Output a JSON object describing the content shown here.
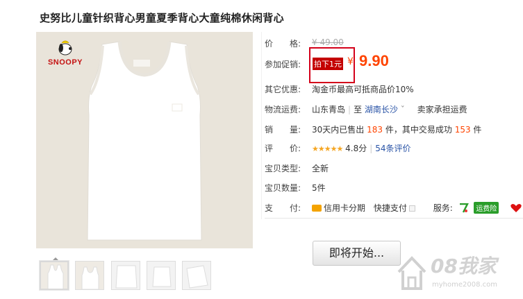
{
  "title": "史努比儿童针织背心男童夏季背心大童纯棉休闲背心",
  "product_image": {
    "brand_text": "SNOOPY"
  },
  "thumbnails_count": 5,
  "price": {
    "label": "价　　格:",
    "original": "¥ 49.00"
  },
  "promo": {
    "label": "参加促销:",
    "tag": "拍下1元",
    "currency": "¥",
    "price": "9.90"
  },
  "other_offer": {
    "label": "其它优惠:",
    "value": "淘金币最高可抵商品价10%"
  },
  "shipping": {
    "label": "物流运费:",
    "from": "山东青岛",
    "to_prefix": "至",
    "to": "湖南长沙",
    "caret": "ˇ",
    "fee": "卖家承担运费"
  },
  "sales": {
    "label": "销　　量:",
    "prefix": "30天内已售出",
    "sold": "183",
    "mid": "件，其中交易成功",
    "success": "153",
    "suffix": "件"
  },
  "rating": {
    "label": "评　　价:",
    "stars": "★★★★★",
    "score": "4.8分",
    "reviews": "54条评价"
  },
  "type": {
    "label": "宝贝类型:",
    "value": "全新"
  },
  "quantity": {
    "label": "宝贝数量:",
    "value": "5件"
  },
  "payment": {
    "label": "支　　付:",
    "credit": "信用卡分期",
    "express": "快捷支付",
    "service_label": "服务:",
    "badge": "运费险"
  },
  "start_button": "即将开始...",
  "watermark": {
    "big": "08我家",
    "small": "myhome2008.com"
  },
  "colors": {
    "accent": "#ff4400",
    "promo_bg": "#c40000",
    "highlight_box": "#d4001a"
  }
}
